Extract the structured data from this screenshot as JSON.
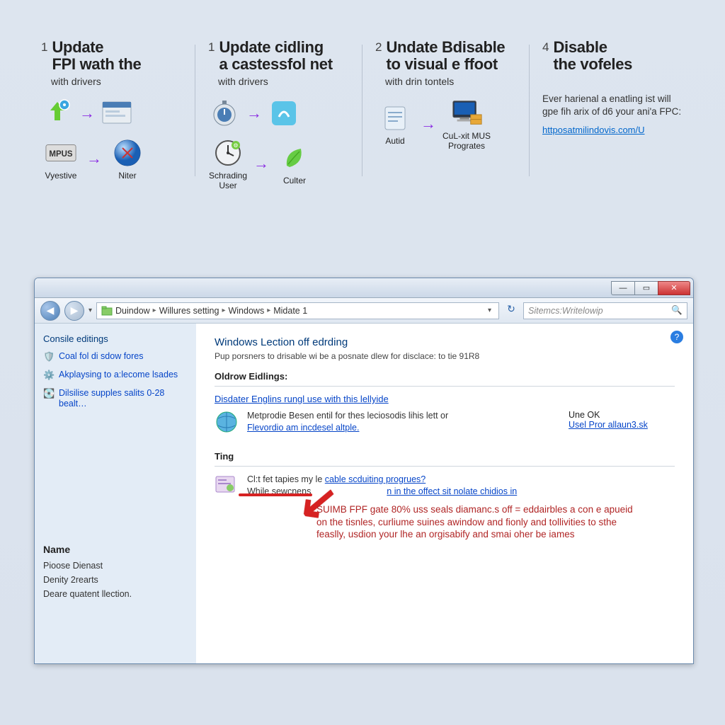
{
  "steps": [
    {
      "num": "1",
      "title_l1": "Update",
      "title_l2": "FPI wath the",
      "sub": "with drivers",
      "row1": {
        "left_label": "",
        "right_label": ""
      },
      "row2": {
        "left_label": "Vyestive",
        "right_label": "Niter"
      },
      "left_tag": "MPUS"
    },
    {
      "num": "1",
      "title_l1": "Update cidling",
      "title_l2": "a castessfol net",
      "sub": "with drivers",
      "row1": {
        "left_label": "",
        "right_label": ""
      },
      "row2": {
        "left_label": "Schrading User",
        "right_label": "Culter"
      }
    },
    {
      "num": "2",
      "title_l1": "Undate Bdisable",
      "title_l2": "to visual e ffoot",
      "sub": "with drin tontels",
      "row1": {
        "left_label": "Autid",
        "right_label": "CuL-xit MUS Progrates"
      }
    },
    {
      "num": "4",
      "title_l1": "Disable",
      "title_l2": "the vofeles",
      "sub": "",
      "body": "Ever harienal a enatling ist will gpe fih arix of d6 your ani'a FPC:",
      "link": "httposatmilindovis.com/U"
    }
  ],
  "window": {
    "titlebar": {
      "min": "—",
      "max": "▭",
      "close": "✕"
    },
    "nav": {
      "back": "◀",
      "fwd": "▶",
      "breadcrumb": [
        "Duindow",
        "Willures setting",
        "Windows",
        "Midate 1"
      ],
      "refresh": "↻",
      "search_placeholder": "Sitemcs:Writelowip",
      "search_icon": "🔍"
    },
    "sidebar": {
      "title": "Consile editings",
      "items": [
        {
          "icon": "shield-icon",
          "text": "Coal fol di sdow fores"
        },
        {
          "icon": "gear-icon",
          "text": "Akplaysing to a:lecome lsades"
        },
        {
          "icon": "disk-icon",
          "text": "Dilsilise supples salits 0-28 bealt…"
        }
      ],
      "name_heading": "Name",
      "names": [
        "Pioose Dienast",
        "Denity 2rearts",
        "Deare quatent llection."
      ]
    },
    "content": {
      "help": "?",
      "h1": "Windows Lection off edrding",
      "desc": "Pup porsners to drisable wi be a posnate dlew for disclace: to tie 91R8",
      "section1_h": "Oldrow Eidlings:",
      "section1_link": "Disdater Englins rungl use with this lellyide",
      "row1_text": "Metprodie Besen entil for thes leciosodis lihis lett or",
      "row1_link": "Flevordio am incdesel altple.",
      "row1_side_line1": "Une OK",
      "row1_side_link": "Usel Pror allaun3.sk",
      "section2_h": "Ting",
      "row2_q_a": "Cl:t fet tapies my le",
      "row2_q_b": "cable scduiting progrues?",
      "row2_body_a": "While sewcnens",
      "row2_body_b": "n in the offect sit nolate chidios in",
      "callout": "SUIMB FPF gate 80% uss seals diamanc.s off = eddairbles a con e apueid on the tisnles, curliume suines awindow and fionly and tollivities to sthe feaslly, usdion your lhe an orgisabify and smai oher be iames"
    }
  }
}
